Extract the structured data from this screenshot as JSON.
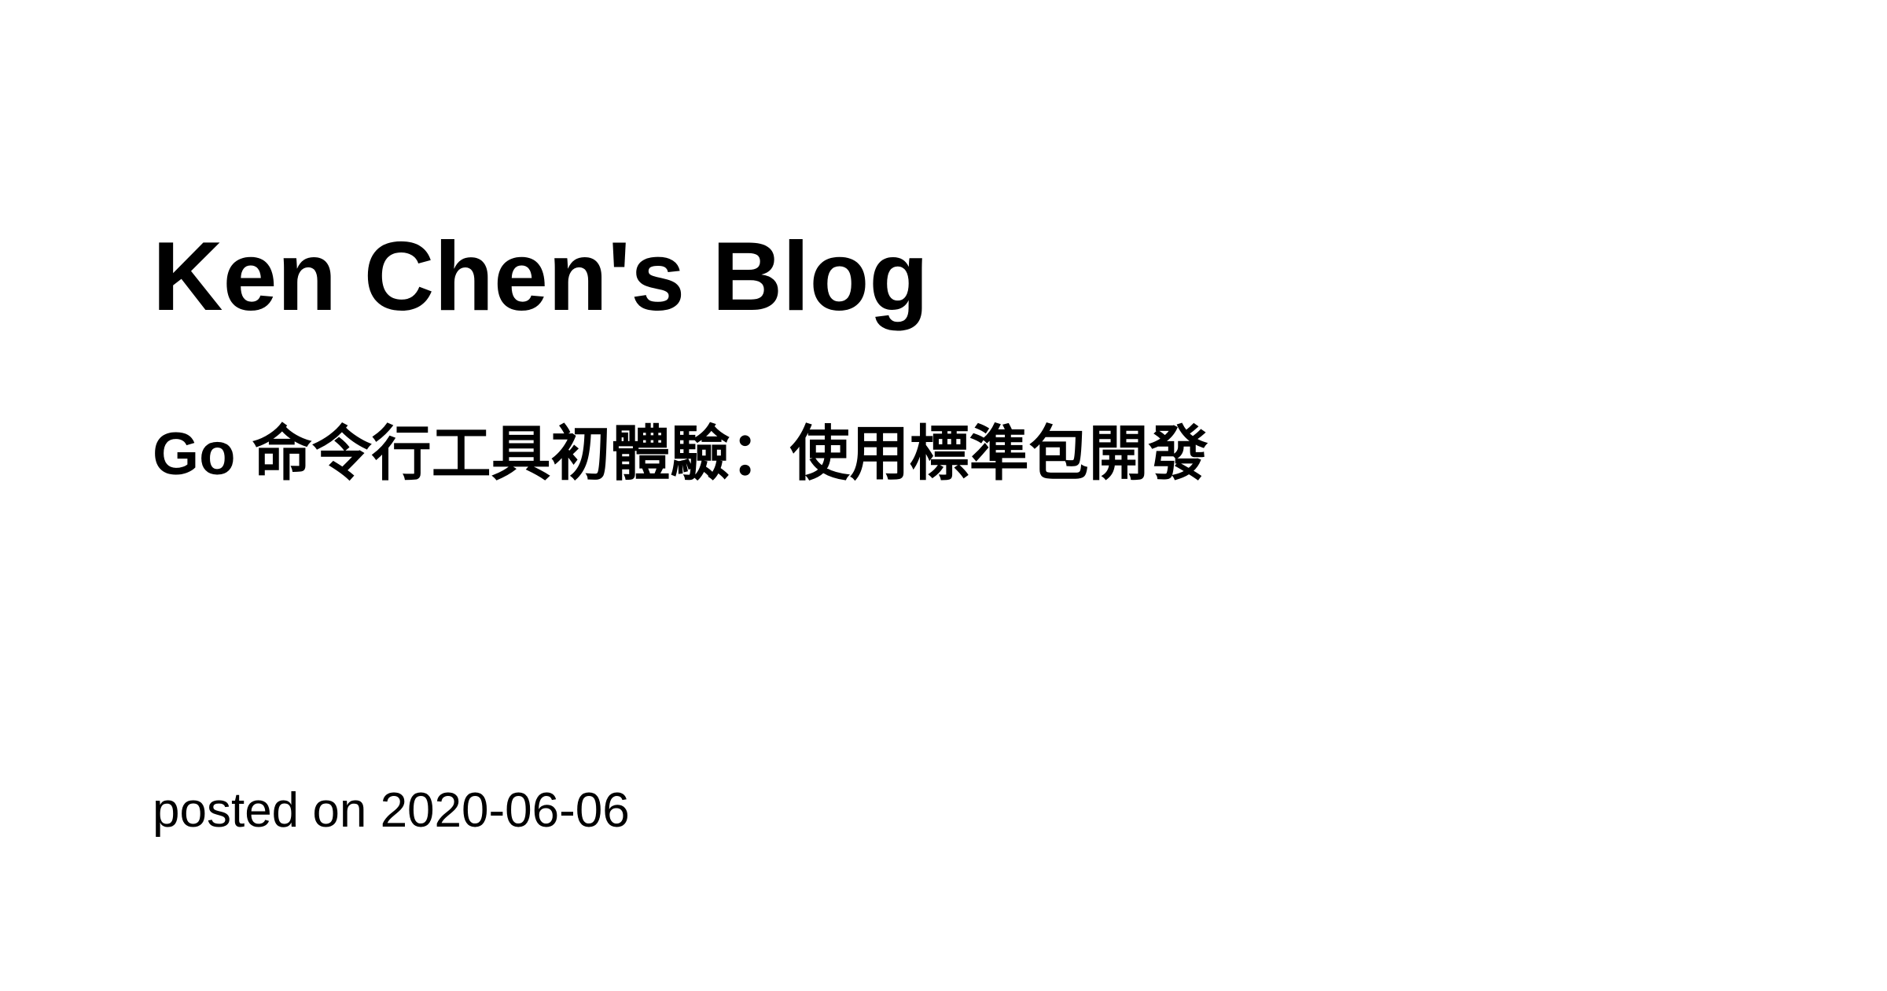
{
  "site": {
    "title": "Ken Chen's Blog"
  },
  "post": {
    "title": "Go 命令行工具初體驗：使用標準包開發",
    "meta": "posted on 2020-06-06"
  }
}
